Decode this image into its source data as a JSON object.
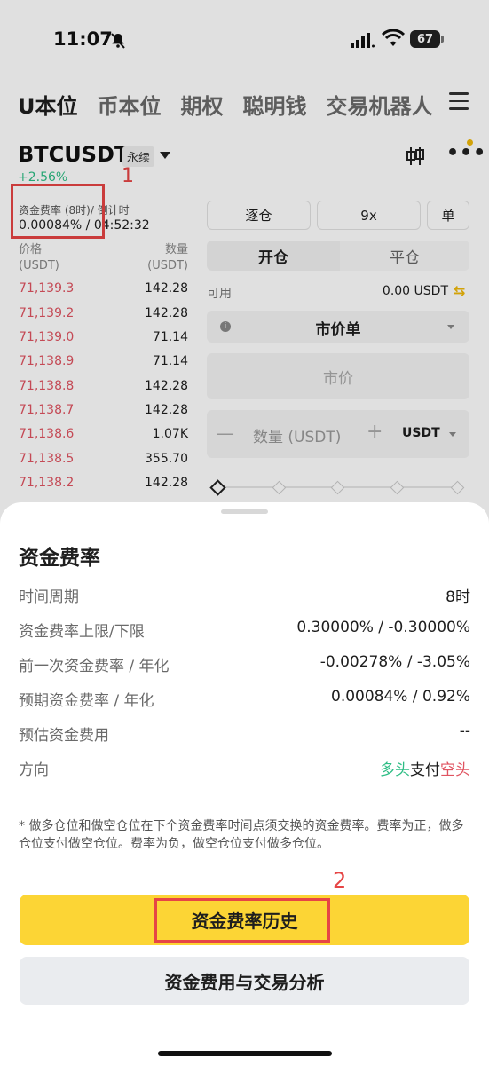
{
  "status_bar": {
    "time": "11:07",
    "battery": "67"
  },
  "nav_tabs": [
    "U本位",
    "币本位",
    "期权",
    "聪明钱",
    "交易机器人"
  ],
  "symbol": {
    "name": "BTCUSDT",
    "badge": "永续",
    "change": "+2.56%"
  },
  "funding": {
    "label": "资金费率 (8时)/ 倒计时",
    "value": "0.00084% / 04:52:32"
  },
  "orderbook": {
    "price_header": [
      "价格",
      "(USDT)"
    ],
    "qty_header": [
      "数量",
      "(USDT)"
    ],
    "rows": [
      {
        "price": "71,139.3",
        "qty": "142.28"
      },
      {
        "price": "71,139.2",
        "qty": "142.28"
      },
      {
        "price": "71,139.0",
        "qty": "71.14"
      },
      {
        "price": "71,138.9",
        "qty": "71.14"
      },
      {
        "price": "71,138.8",
        "qty": "142.28"
      },
      {
        "price": "71,138.7",
        "qty": "142.28"
      },
      {
        "price": "71,138.6",
        "qty": "1.07K"
      },
      {
        "price": "71,138.5",
        "qty": "355.70"
      },
      {
        "price": "71,138.2",
        "qty": "142.28"
      }
    ]
  },
  "trade_panel": {
    "margin_mode": "逐仓",
    "leverage": "9x",
    "position_mode": "单",
    "tab_open": "开仓",
    "tab_close": "平仓",
    "available_label": "可用",
    "available_value": "0.00 USDT",
    "order_type": "市价单",
    "price_placeholder": "市价",
    "qty_placeholder": "数量 (USDT)",
    "qty_unit": "USDT",
    "minus": "—",
    "plus": "+"
  },
  "annotations": {
    "one": "1",
    "two": "2"
  },
  "sheet": {
    "title": "资金费率",
    "rows": [
      {
        "label": "时间周期",
        "value": "8时"
      },
      {
        "label": "资金费率上限/下限",
        "value": "0.30000% / -0.30000%"
      },
      {
        "label": "前一次资金费率 / 年化",
        "value": "-0.00278% / -3.05%"
      },
      {
        "label": "预期资金费率 / 年化",
        "value": "0.00084% / 0.92%"
      },
      {
        "label": "预估资金费用",
        "value": "--"
      }
    ],
    "direction": {
      "label": "方向",
      "long": "多头",
      "pay": "支付",
      "short": "空头"
    },
    "footnote": "* 做多仓位和做空仓位在下个资金费率时间点须交换的资金费率。费率为正，做多仓位支付做空仓位。费率为负，做空仓位支付做多仓位。",
    "primary_button": "资金费率历史",
    "secondary_button": "资金费用与交易分析"
  },
  "colors": {
    "accent": "#fcd535",
    "long": "#2ebd85",
    "short": "#e05461",
    "annotation": "#e64545"
  }
}
